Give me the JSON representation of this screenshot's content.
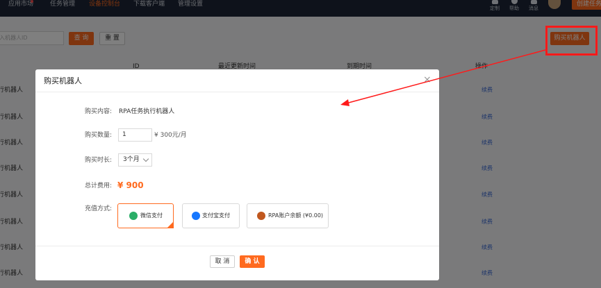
{
  "topnav": {
    "items": [
      "应用市场",
      "任务管理",
      "设备控制台",
      "下载客户端",
      "管理设置"
    ],
    "active_index": 2,
    "icons": [
      {
        "name": "customize-icon",
        "label": "定制"
      },
      {
        "name": "help-icon",
        "label": "帮助"
      },
      {
        "name": "message-icon",
        "label": "消息"
      }
    ],
    "create_label": "创建任务"
  },
  "toolbar": {
    "search_placeholder": "入机器人ID",
    "query_label": "查 询",
    "reset_label": "重 置",
    "buy_label": "购买机器人"
  },
  "table": {
    "headers": [
      "ID",
      "最近更新时间",
      "到期时间",
      "操作"
    ],
    "rows": [
      {
        "name": "行机器人",
        "action": "续费"
      },
      {
        "name": "行机器人",
        "action": "续费"
      },
      {
        "name": "行机器人",
        "action": "续费"
      },
      {
        "name": "行机器人",
        "action": "续费"
      },
      {
        "name": "行机器人",
        "action": "续费"
      },
      {
        "name": "行机器人",
        "action": "续费"
      },
      {
        "name": "行机器人",
        "action": "续费"
      },
      {
        "name": "行机器人",
        "action": "续费"
      }
    ]
  },
  "modal": {
    "title": "购买机器人",
    "close": "×",
    "content_label": "购买内容:",
    "content_value": "RPA任务执行机器人",
    "qty_label": "购买数量:",
    "qty_value": "1",
    "unit_price": "¥ 300元/月",
    "duration_label": "购买时长:",
    "duration_value": "3个月",
    "total_label": "总计费用:",
    "total_value": "¥ 900",
    "pay_label": "充值方式:",
    "pay_methods": [
      {
        "label": "微信支付",
        "icon": "wechat-icon",
        "color": "#2aae67",
        "selected": true
      },
      {
        "label": "支付宝支付",
        "icon": "alipay-icon",
        "color": "#1677ff",
        "selected": false
      },
      {
        "label": "RPA账户余额 (¥0.00)",
        "icon": "wallet-icon",
        "color": "#c0571e",
        "selected": false
      }
    ],
    "cancel_label": "取 消",
    "confirm_label": "确 认"
  },
  "colors": {
    "accent": "#ff6a1f",
    "nav_bg": "#1c2536",
    "link": "#3b6ad4",
    "annotation": "#ff1a1a"
  }
}
